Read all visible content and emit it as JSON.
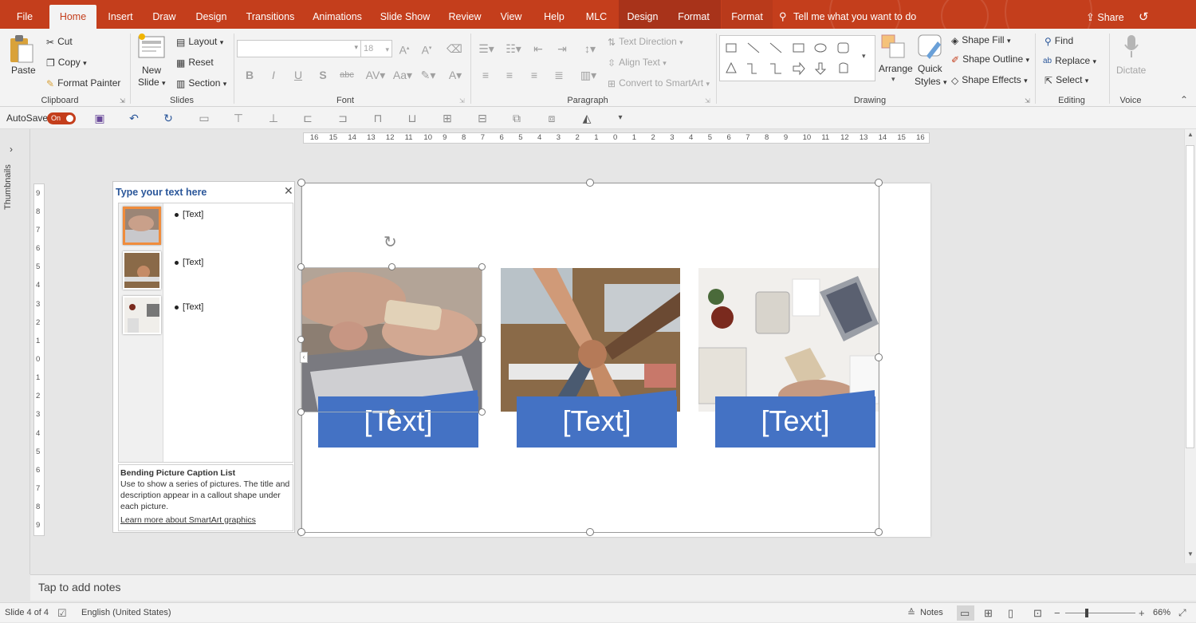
{
  "tabs": [
    "File",
    "Home",
    "Insert",
    "Draw",
    "Design",
    "Transitions",
    "Animations",
    "Slide Show",
    "Review",
    "View",
    "Help",
    "MLC",
    "Design",
    "Format",
    "Format"
  ],
  "active_tab": "Home",
  "tellme": "Tell me what you want to do",
  "share": "Share",
  "clipboard": {
    "paste": "Paste",
    "cut": "Cut",
    "copy": "Copy",
    "format_painter": "Format Painter",
    "label": "Clipboard"
  },
  "slides": {
    "new_slide_1": "New",
    "new_slide_2": "Slide",
    "layout": "Layout",
    "reset": "Reset",
    "section": "Section",
    "label": "Slides"
  },
  "font": {
    "size": "18",
    "label": "Font"
  },
  "paragraph": {
    "text_direction": "Text Direction",
    "align_text": "Align Text",
    "convert": "Convert to SmartArt",
    "label": "Paragraph"
  },
  "drawing": {
    "arrange": "Arrange",
    "quick_1": "Quick",
    "quick_2": "Styles",
    "fill": "Shape Fill",
    "outline": "Shape Outline",
    "effects": "Shape Effects",
    "label": "Drawing"
  },
  "editing": {
    "find": "Find",
    "replace": "Replace",
    "select": "Select",
    "label": "Editing"
  },
  "voice": {
    "dictate": "Dictate",
    "label": "Voice"
  },
  "qat": {
    "autosave": "AutoSave",
    "toggle": "On"
  },
  "thumbnails_label": "Thumbnails",
  "hruler_ticks": [
    "16",
    "15",
    "14",
    "13",
    "12",
    "11",
    "10",
    "9",
    "8",
    "7",
    "6",
    "5",
    "4",
    "3",
    "2",
    "1",
    "0",
    "1",
    "2",
    "3",
    "4",
    "5",
    "6",
    "7",
    "8",
    "9",
    "10",
    "11",
    "12",
    "13",
    "14",
    "15",
    "16"
  ],
  "vruler_ticks": [
    "9",
    "8",
    "7",
    "6",
    "5",
    "4",
    "3",
    "2",
    "1",
    "0",
    "1",
    "2",
    "3",
    "4",
    "5",
    "6",
    "7",
    "8",
    "9"
  ],
  "text_pane": {
    "title": "Type your text here",
    "items": [
      "[Text]",
      "[Text]",
      "[Text]"
    ],
    "info_title": "Bending Picture Caption List",
    "info_desc": "Use to show a series of pictures. The title and description appear in a callout shape under each picture.",
    "info_link": "Learn more about SmartArt graphics"
  },
  "captions": [
    "[Text]",
    "[Text]",
    "[Text]"
  ],
  "notes": "Tap to add notes",
  "status": {
    "slide": "Slide 4 of 4",
    "language": "English (United States)",
    "notes": "Notes",
    "zoom": "66%"
  },
  "colors": {
    "accent": "#c43e1c",
    "caption": "#4472c4"
  }
}
